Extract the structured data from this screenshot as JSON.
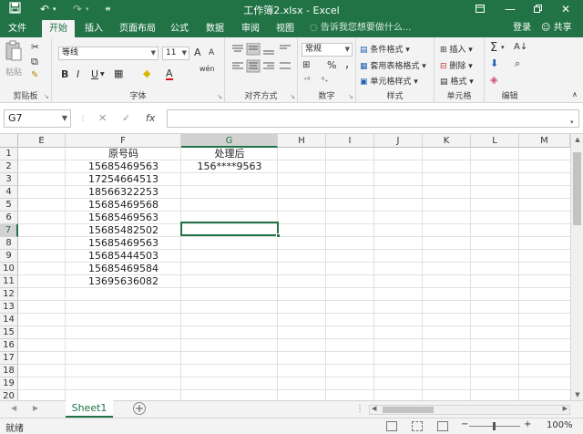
{
  "title_bar": {
    "title": "工作簿2.xlsx - Excel",
    "save_icon": "save-icon",
    "undo_icon": "undo-icon",
    "redo_icon": "redo-icon"
  },
  "tabs": [
    {
      "label": "文件"
    },
    {
      "label": "开始"
    },
    {
      "label": "插入"
    },
    {
      "label": "页面布局"
    },
    {
      "label": "公式"
    },
    {
      "label": "数据"
    },
    {
      "label": "审阅"
    },
    {
      "label": "视图"
    }
  ],
  "tell_me": "告诉我您想要做什么...",
  "login": "登录",
  "share": "共享",
  "ribbon": {
    "clipboard": {
      "label": "剪贴板",
      "paste": "粘贴"
    },
    "font": {
      "label": "字体",
      "font_name": "等线",
      "font_size": "11",
      "bold": "B",
      "italic": "I",
      "underline": "U",
      "grow": "A",
      "shrink": "A",
      "font_color": "A",
      "pinyin": "wén"
    },
    "alignment": {
      "label": "对齐方式"
    },
    "number": {
      "label": "数字",
      "format": "常规",
      "percent": "%",
      "comma": ","
    },
    "styles": {
      "label": "样式",
      "conditional": "条件格式",
      "table": "套用表格格式",
      "cell_styles": "单元格样式"
    },
    "cells": {
      "label": "单元格",
      "insert": "插入",
      "delete": "删除",
      "format": "格式"
    },
    "editing": {
      "label": "编辑",
      "sum": "Σ"
    }
  },
  "formula_bar": {
    "name_box": "G7",
    "cancel": "✕",
    "enter": "✓",
    "fx": "fx",
    "value": ""
  },
  "columns": [
    "E",
    "F",
    "G",
    "H",
    "I",
    "J",
    "K",
    "L",
    "M"
  ],
  "rows": [
    "1",
    "2",
    "3",
    "4",
    "5",
    "6",
    "7",
    "8",
    "9",
    "10",
    "11",
    "12",
    "13",
    "14",
    "15",
    "16",
    "17",
    "18",
    "19",
    "20"
  ],
  "cells": {
    "F": [
      "原号码",
      "15685469563",
      "17254664513",
      "18566322253",
      "15685469568",
      "15685469563",
      "15685482502",
      "15685469563",
      "15685444503",
      "15685469584",
      "13695636082"
    ],
    "G": [
      "处理后",
      "156****9563"
    ]
  },
  "selected_cell": "G7",
  "sheet_tab": "Sheet1",
  "add_sheet": "⊕",
  "status": {
    "ready": "就绪",
    "zoom_out": "−",
    "zoom_in": "+",
    "zoom": "100%"
  }
}
